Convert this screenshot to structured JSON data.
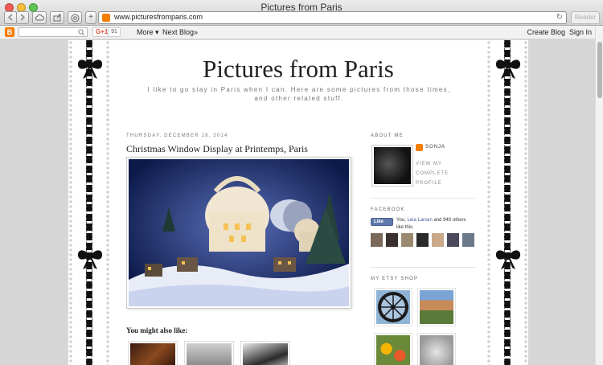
{
  "window": {
    "title": "Pictures from Paris"
  },
  "toolbar": {
    "url": "www.picturesfromparis.com",
    "reader_label": "Reader",
    "add_label": "+"
  },
  "navbar": {
    "gplus_label": "G+1",
    "gplus_count": "91",
    "more_label": "More ▾",
    "next_blog_label": "Next Blog»",
    "create_blog_label": "Create Blog",
    "sign_in_label": "Sign In"
  },
  "blog": {
    "title": "Pictures from Paris",
    "description": "I like to go stay in Paris when I can. Here are some pictures from those times, and other related stuff."
  },
  "post": {
    "date": "THURSDAY, DECEMBER 18, 2014",
    "title": "Christmas Window Display at Printemps, Paris",
    "also_like_heading": "You might also like:"
  },
  "sidebar": {
    "about_heading": "ABOUT ME",
    "profile_name": "SONJA",
    "profile_link": "VIEW MY COMPLETE PROFILE",
    "facebook_heading": "FACEBOOK",
    "like_label": "Like",
    "like_prefix": "You, ",
    "like_friend": "Leia Larsen",
    "like_suffix": " and 940 others like this.",
    "etsy_heading": "MY ETSY SHOP"
  },
  "icons": {
    "back": "back-arrow-icon",
    "forward": "forward-arrow-icon",
    "cloud": "icloud-icon",
    "share": "share-icon",
    "topsites": "top-sites-icon",
    "reload": "reload-icon",
    "search": "search-icon",
    "bow": "bow-ribbon-icon"
  },
  "colors": {
    "blogger_orange": "#f57d00",
    "facebook_blue": "#5f78ab",
    "gplus_red": "#dd4b39"
  }
}
